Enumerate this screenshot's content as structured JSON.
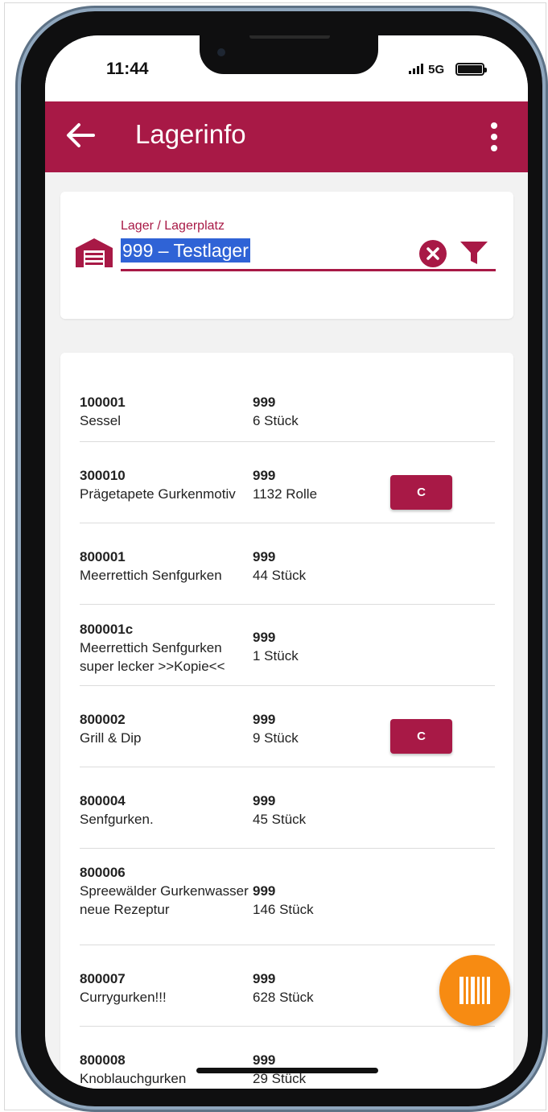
{
  "status_bar": {
    "time": "11:44",
    "network": "5G"
  },
  "header": {
    "title": "Lagerinfo"
  },
  "search": {
    "label": "Lager / Lagerplatz",
    "value": "999 – Testlager"
  },
  "items": [
    {
      "nr": "100001",
      "desc": "Sessel",
      "lager": "999",
      "menge": "6 Stück",
      "button": ""
    },
    {
      "nr": "300010",
      "desc": "Prägetapete Gurkenmotiv",
      "lager": "999",
      "menge": "1132 Rolle",
      "button": "C"
    },
    {
      "nr": "800001",
      "desc": "Meerrettich Senfgurken",
      "lager": "999",
      "menge": "44 Stück",
      "button": ""
    },
    {
      "nr": "800001c",
      "desc": "Meerrettich Senfgurken super lecker >>Kopie<<",
      "lager": "999",
      "menge": "1 Stück",
      "button": ""
    },
    {
      "nr": "800002",
      "desc": "Grill & Dip",
      "lager": "999",
      "menge": "9 Stück",
      "button": "C"
    },
    {
      "nr": "800004",
      "desc": "Senfgurken.",
      "lager": "999",
      "menge": "45 Stück",
      "button": ""
    },
    {
      "nr": "800006",
      "desc": "Spreewälder Gurkenwasser neue Rezeptur",
      "lager": "999",
      "menge": "146 Stück",
      "button": ""
    },
    {
      "nr": "800007",
      "desc": "Currygurken!!!",
      "lager": "999",
      "menge": "628 Stück",
      "button": ""
    },
    {
      "nr": "800008",
      "desc": "Knoblauchgurken",
      "lager": "999",
      "menge": "29 Stück",
      "button": ""
    }
  ],
  "icons": {
    "back": "arrow-left-icon",
    "menu": "more-vertical-icon",
    "warehouse": "warehouse-icon",
    "clear": "clear-icon",
    "filter": "filter-icon",
    "scan": "barcode-icon"
  },
  "colors": {
    "primary": "#a81946",
    "fab": "#f78b12",
    "selection": "#2f63d6"
  }
}
